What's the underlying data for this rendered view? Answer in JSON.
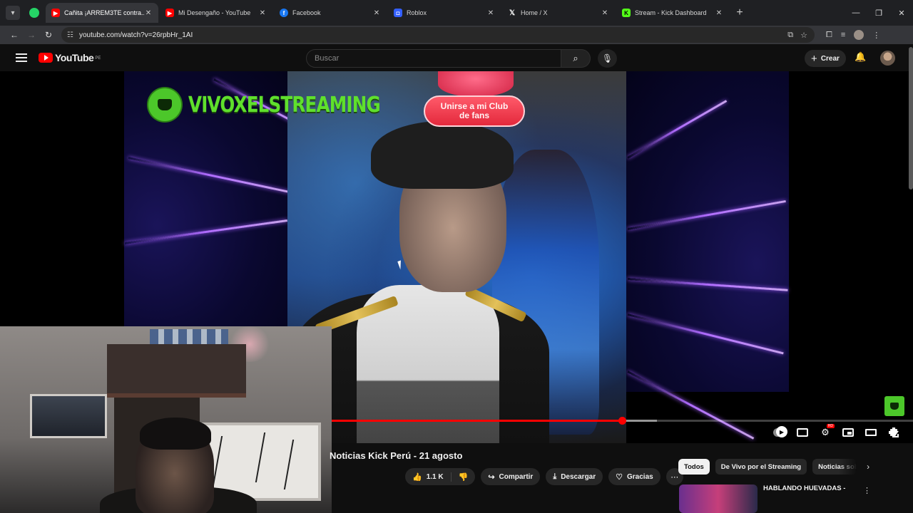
{
  "browser": {
    "tabs": [
      {
        "title": "Cañita ¡ARREM3TE contra...",
        "favicon": "youtube",
        "close": "✕"
      },
      {
        "title": "Mi Desengaño - YouTube",
        "favicon": "youtube",
        "close": "✕"
      },
      {
        "title": "Facebook",
        "favicon": "facebook",
        "close": "✕"
      },
      {
        "title": "Roblox",
        "favicon": "roblox",
        "close": "✕"
      },
      {
        "title": "Home / X",
        "favicon": "x",
        "close": "✕"
      },
      {
        "title": "Stream - Kick Dashboard",
        "favicon": "kick",
        "close": "✕"
      }
    ],
    "new_tab": "+",
    "window_controls": {
      "minimize": "—",
      "restore": "❐",
      "close": "✕"
    },
    "url": "youtube.com/watch?v=26rpbHr_1AI"
  },
  "youtube": {
    "logo_text": "YouTube",
    "country_code": "PE",
    "search_placeholder": "Buscar",
    "create_label": "Crear",
    "create_plus": "+"
  },
  "video": {
    "brand_text": "VIVOXELSTREAMING",
    "fanclub_line1": "Unirse a mi Club",
    "fanclub_line2": "de fans",
    "progress": 0.5,
    "buffered": 0.56,
    "title": "Noticias Kick Perú - 21 agosto"
  },
  "actions": {
    "likes": "1.1 K",
    "share": "Compartir",
    "download": "Descargar",
    "thanks": "Gracias",
    "more": "⋯"
  },
  "chips": [
    "Todos",
    "De Vivo por el Streaming",
    "Noticias sobre"
  ],
  "recommendation": {
    "title": "HABLANDO HUEVADAS -",
    "more": "⋮"
  },
  "colors": {
    "accent": "#ff0000",
    "brand_green": "#5fe02c"
  }
}
